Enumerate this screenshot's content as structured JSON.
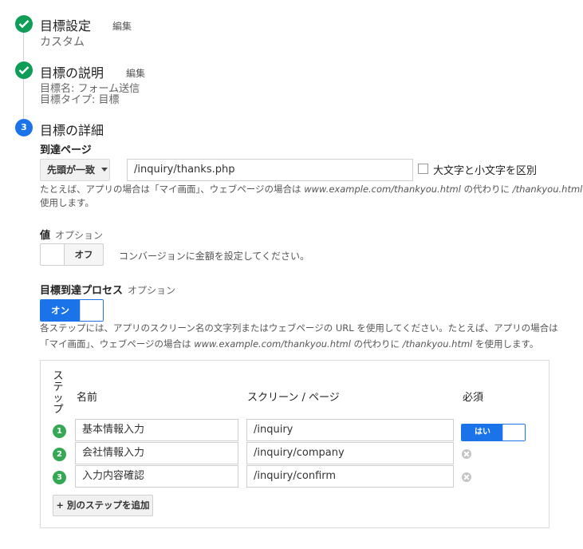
{
  "steps": [
    {
      "title": "目標設定",
      "edit": "編集",
      "summary": [
        "カスタム"
      ]
    },
    {
      "title": "目標の説明",
      "edit": "編集",
      "summary": [
        "目標名: フォーム送信",
        "目標タイプ: 目標"
      ]
    },
    {
      "number": "3",
      "title": "目標の詳細"
    }
  ],
  "destination": {
    "label": "到達ページ",
    "match_type": "先頭が一致",
    "value": "/inquiry/thanks.php",
    "case_sensitive_label": "大文字と小文字を区別",
    "help_parts": [
      "たとえば、アプリの場合は「マイ画面」、ウェブページの場合は",
      "www.example.com/thankyou.html",
      "の代わりに",
      "/thankyou.html",
      "を"
    ],
    "help_line2": "使用します。"
  },
  "value": {
    "label": "値",
    "optional": "オプション",
    "toggle": "オフ",
    "description": "コンバージョンに金額を設定してください。"
  },
  "funnel": {
    "label": "目標到達プロセス",
    "optional": "オプション",
    "toggle": "オン",
    "help_line1": "各ステップには、アプリのスクリーン名の文字列またはウェブページの URL を使用してください。たとえば、アプリの場合は",
    "help_line2_parts": [
      "「マイ画面」、ウェブページの場合は",
      "www.example.com/thankyou.html",
      "の代わりに",
      "/thankyou.html",
      "を使用します。"
    ],
    "headers": {
      "step": "ステップ",
      "name": "名前",
      "screen": "スクリーン / ページ",
      "required": "必須"
    },
    "rows": [
      {
        "num": "1",
        "name": "基本情報入力",
        "page": "/inquiry",
        "required": "はい"
      },
      {
        "num": "2",
        "name": "会社情報入力",
        "page": "/inquiry/company"
      },
      {
        "num": "3",
        "name": "入力内容確認",
        "page": "/inquiry/confirm"
      }
    ],
    "add_button": "+ 別のステップを追加"
  },
  "colors": {
    "done": "#0f9d58",
    "active": "#1a73e8",
    "step": "#34a853"
  }
}
